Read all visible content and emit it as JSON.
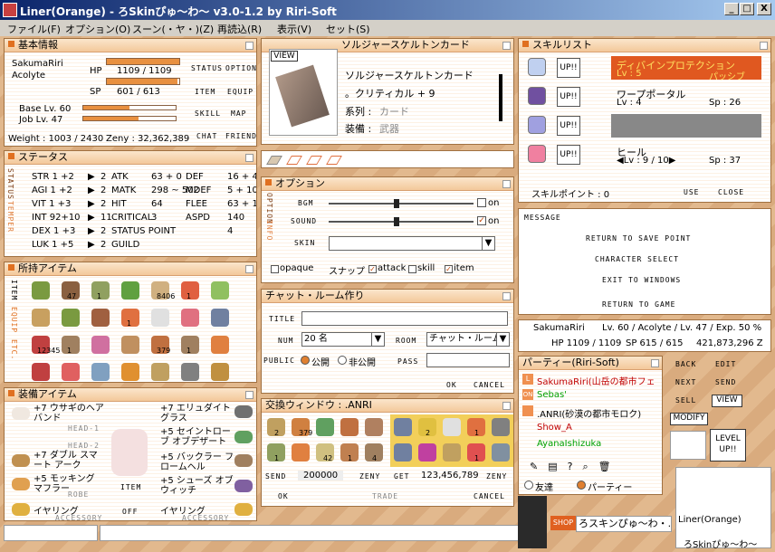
{
  "titlebar": {
    "title": "Liner(Orange) - ろSkinぴゅ〜わ〜 v3.0-1.2 by Riri-Soft",
    "minimize": "_",
    "maximize": "□",
    "close": "X"
  },
  "menu": [
    "ファイル(F)",
    "オプション(O)",
    "スーン(・ヤ・)(Z)",
    "再読込(R)",
    "表示(V)",
    "セット(S)"
  ],
  "basic": {
    "title": "基本情報",
    "name": "SakumaRiri",
    "job": "Acolyte",
    "hp_label": "HP",
    "hp": "1109 / 1109",
    "hp_fill": 1.0,
    "sp_label": "SP",
    "sp": "601 / 613",
    "sp_fill": 0.98,
    "base_lv": "Base Lv. 60",
    "job_lv": "Job Lv. 47",
    "base_exp_fill": 0.5,
    "job_exp_fill": 0.6,
    "weight": "Weight : 1003 / 2430",
    "zeny": "Zeny : 32,362,389",
    "btns": [
      "STATUS",
      "OPTION",
      "ITEM",
      "EQUIP",
      "SKILL",
      "MAP",
      "CHAT",
      "FRIEND"
    ]
  },
  "status": {
    "title": "ステータス",
    "side": "STATUS",
    "side2": "TEMPER",
    "rows": [
      {
        "s": "STR 1 +2",
        "p": "2",
        "k": "ATK",
        "v": "63 + 0",
        "k2": "DEF",
        "v2": "16 + 4"
      },
      {
        "s": "AGI 1 +2",
        "p": "2",
        "k": "MATK",
        "v": "298 ~ 502",
        "k2": "MDEF",
        "v2": "5 + 102"
      },
      {
        "s": "VIT 1 +3",
        "p": "2",
        "k": "HIT",
        "v": "64",
        "k2": "FLEE",
        "v2": "63 + 1"
      },
      {
        "s": "INT 92+10",
        "p": "11",
        "k": "CRITICAL",
        "v": "3",
        "k2": "ASPD",
        "v2": "140"
      },
      {
        "s": "DEX 1 +3",
        "p": "2",
        "k": "STATUS POINT",
        "v": "",
        "k2": "",
        "v2": "4"
      },
      {
        "s": "LUK 1 +5",
        "p": "2",
        "k": "GUILD",
        "v": "",
        "k2": "",
        "v2": ""
      }
    ]
  },
  "inventory": {
    "title": "所持アイテム",
    "tabs": [
      "ITEM",
      "EQUIP",
      "ETC."
    ],
    "counts": [
      "",
      "47",
      "1",
      "",
      "8406",
      "1",
      "",
      "",
      "",
      "",
      "1",
      "",
      "",
      "",
      "12345",
      "1",
      "",
      "",
      "379",
      "1",
      "",
      "",
      "",
      "",
      "",
      "",
      "",
      ""
    ]
  },
  "equip": {
    "title": "装備アイテム",
    "left": [
      "+7 ウサギのヘアバンド",
      "HEAD-1",
      "HEAD-2",
      "+7 ダブル スマート アーク",
      "+5 モッキング マフラー",
      "ROBE",
      "イヤリング",
      "ACCESSORY"
    ],
    "right": [
      "+7 エリュダイト グラス",
      "+5 セイントローブ オブデザート",
      "+5 バックラー フロームヘル",
      "+5 シューズ オブ ウィッチ",
      "イヤリング",
      "ACCESSORY"
    ],
    "mid": [
      "ITEM",
      "OFF"
    ]
  },
  "card": {
    "title": "ソルジャースケルトンカード",
    "view": "VIEW",
    "name": "ソルジャースケルトンカード",
    "desc": "。クリティカル + 9",
    "type_l": "系列 :",
    "type_v": "カード",
    "eq_l": "装備 :",
    "eq_v": "武器"
  },
  "option": {
    "title": "オプション",
    "side": "OPTION",
    "side2": "INFO",
    "bgm": "BGM",
    "sound": "SOUND",
    "skin": "SKIN",
    "on": "on",
    "opaque": "opaque",
    "snap": "スナップ",
    "attack": "attack",
    "skill": "skill",
    "item": "item"
  },
  "chatroom": {
    "title": "チャット・ルーム作り",
    "title_l": "TITLE",
    "num_l": "NUM",
    "num_v": "20 名",
    "room_l": "ROOM",
    "room_v": "チャット・ルーム",
    "public_l": "PUBLIC",
    "pub": "公開",
    "priv": "非公開",
    "pass": "PASS",
    "ok": "OK",
    "cancel": "CANCEL"
  },
  "trade": {
    "title": "交換ウィンドウ : .ANRI",
    "send_l": "SEND",
    "send_v": "200000",
    "zeny": "ZENY",
    "get_l": "GET",
    "get_v": "123,456,789",
    "zeny2": "ZENY",
    "ok": "OK",
    "trade": "TRADE",
    "cancel": "CANCEL",
    "counts_l": [
      "2",
      "379",
      "",
      "",
      "",
      "1",
      "",
      "42",
      "1",
      "4"
    ],
    "counts_r": [
      "",
      "2",
      "",
      "1",
      "",
      "",
      "",
      "",
      "1",
      ""
    ]
  },
  "skills": {
    "title": "スキルリスト",
    "up": "UP!!",
    "list": [
      {
        "n": "ディバインプロテクション",
        "a": "Lv : 5",
        "b": "パッシブ"
      },
      {
        "n": "ワープポータル",
        "a": "Lv : 4",
        "b": "Sp : 26"
      },
      {
        "n": "",
        "a": "",
        "b": ""
      },
      {
        "n": "ヒール",
        "a": "◀Lv : 9 / 10▶",
        "b": "Sp : 37"
      }
    ],
    "points": "スキルポイント : 0",
    "use": "USE",
    "close": "CLOSE"
  },
  "message": {
    "title": "MESSAGE",
    "items": [
      "RETURN TO SAVE POINT",
      "CHARACTER SELECT",
      "EXIT TO WINDOWS",
      "RETURN TO GAME"
    ]
  },
  "charinfo": {
    "name": "SakumaRiri",
    "lv": "Lv. 60 / Acolyte / Lv. 47 / Exp. 50 %",
    "hp": "HP 1109 / 1109",
    "sp": "SP 615 / 615",
    "zeny": "421,873,296 Z"
  },
  "party": {
    "title": "パーティー(Riri-Soft)",
    "members": [
      "SakumaRiri(山岳の都市フェ",
      "Sebas'",
      ".ANRI(砂漠の都市モロク)",
      "Show_A",
      "AyanaIshizuka"
    ],
    "friend": "友達",
    "party": "パーティー"
  },
  "side_btns": {
    "back": "BACK",
    "edit": "EDIT",
    "next": "NEXT",
    "send": "SEND",
    "sell": "SELL",
    "view": "VIEW",
    "modify": "MODIFY",
    "level": "LEVEL UP!!"
  },
  "shop": {
    "badge": "SHOP",
    "text": "ろスキンぴゅ〜わ・..."
  },
  "minimap": {
    "name": "Liner(Orange)",
    "sub": "ろSkinぴゅ〜わ〜"
  },
  "colors": {
    "accent": "#e07020",
    "title": "#0a246a"
  }
}
